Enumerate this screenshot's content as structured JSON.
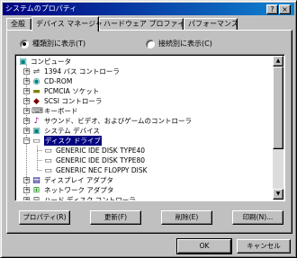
{
  "window": {
    "title": "システムのプロパティ",
    "help_btn": "?",
    "close_btn": "×"
  },
  "tabs": [
    {
      "label": "全般"
    },
    {
      "label": "デバイス マネージャ"
    },
    {
      "label": "ハードウェア プロファイル"
    },
    {
      "label": "パフォーマンス"
    }
  ],
  "view": {
    "by_type_label": "種類別に表示(T)",
    "by_connection_label": "接続別に表示(C)",
    "selected": "by_type"
  },
  "tree": {
    "root": "コンピュータ",
    "items": [
      {
        "label": "1394 バス コントローラ",
        "icon": "bus-controller-icon",
        "glyph": "⇌",
        "expander": "+"
      },
      {
        "label": "CD-ROM",
        "icon": "cdrom-icon",
        "glyph": "◉",
        "expander": "+"
      },
      {
        "label": "PCMCIA ソケット",
        "icon": "pcmcia-icon",
        "glyph": "▬",
        "expander": "+"
      },
      {
        "label": "SCSI コントローラ",
        "icon": "scsi-icon",
        "glyph": "◆",
        "expander": "+"
      },
      {
        "label": "キーボード",
        "icon": "keyboard-icon",
        "glyph": "⌨",
        "expander": "+"
      },
      {
        "label": "サウンド、ビデオ、およびゲームのコントローラ",
        "icon": "sound-icon",
        "glyph": "♪",
        "expander": "+"
      },
      {
        "label": "システム デバイス",
        "icon": "system-device-icon",
        "glyph": "▣",
        "expander": "+"
      },
      {
        "label": "ディスク ドライブ",
        "icon": "disk-drive-icon",
        "glyph": "▭",
        "expander": "−",
        "selected": true
      },
      {
        "label": "GENERIC IDE  DISK TYPE40",
        "icon": "disk-icon",
        "glyph": "▭",
        "child": true
      },
      {
        "label": "GENERIC IDE  DISK TYPE80",
        "icon": "disk-icon",
        "glyph": "▭",
        "child": true
      },
      {
        "label": "GENERIC NEC  FLOPPY DISK",
        "icon": "floppy-icon",
        "glyph": "▭",
        "child": true
      },
      {
        "label": "ディスプレイ アダプタ",
        "icon": "display-adapter-icon",
        "glyph": "▤",
        "expander": "+"
      },
      {
        "label": "ネットワーク アダプタ",
        "icon": "network-adapter-icon",
        "glyph": "⊞",
        "expander": "+"
      },
      {
        "label": "ハード ディスク コントローラ",
        "icon": "hdd-controller-icon",
        "glyph": "⊟",
        "expander": "+"
      }
    ]
  },
  "buttons": {
    "properties": "プロパティ(R)",
    "refresh": "更新(F)",
    "remove": "削除(E)",
    "print": "印刷(N)...",
    "ok": "OK",
    "cancel": "キャンセル"
  },
  "colors": {
    "title_bar": "#000080",
    "selection": "#000080",
    "face": "#c0c0c0"
  }
}
